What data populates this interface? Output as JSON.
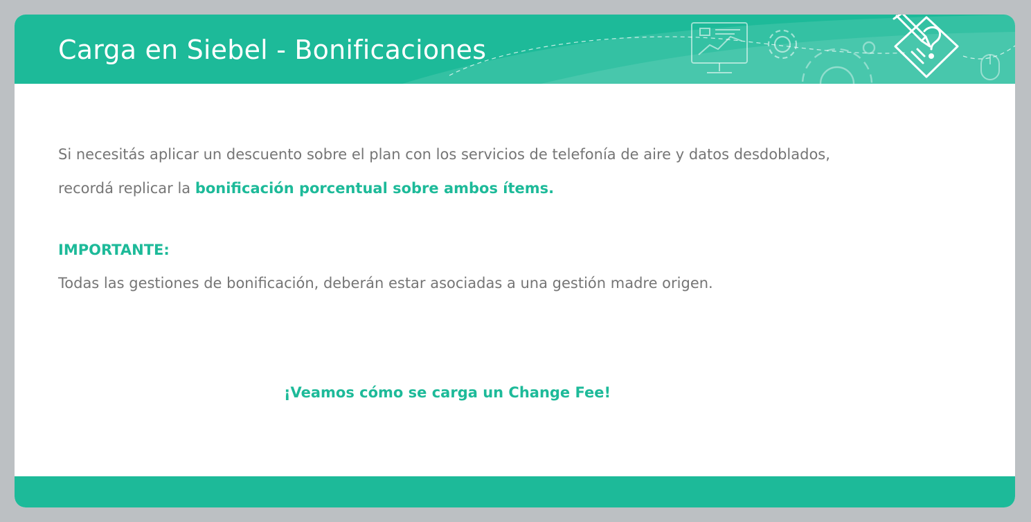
{
  "header": {
    "title": "Carga en Siebel - Bonificaciones"
  },
  "body": {
    "paragraph_line1": "Si necesitás aplicar un descuento sobre el plan con los servicios de telefonía de aire y datos desdoblados,",
    "paragraph_line2_prefix": "recordá replicar la ",
    "paragraph_line2_emphasis": "bonificación porcentual sobre ambos ítems.",
    "important_label": "IMPORTANTE:",
    "important_text": "Todas las gestiones de bonificación, deberán estar asociadas a una gestión madre origen.",
    "call_to_action": "¡Veamos cómo se carga un Change Fee!"
  },
  "colors": {
    "accent": "#1dba99",
    "body_text": "#757575",
    "background": "#bcc0c3",
    "panel": "#ffffff"
  },
  "icons": {
    "header_decorations": [
      "monitor-chart-icon",
      "gear-icon",
      "large-gear-icon",
      "mouse-icon"
    ],
    "logo": "document-pencil-question-icon"
  }
}
